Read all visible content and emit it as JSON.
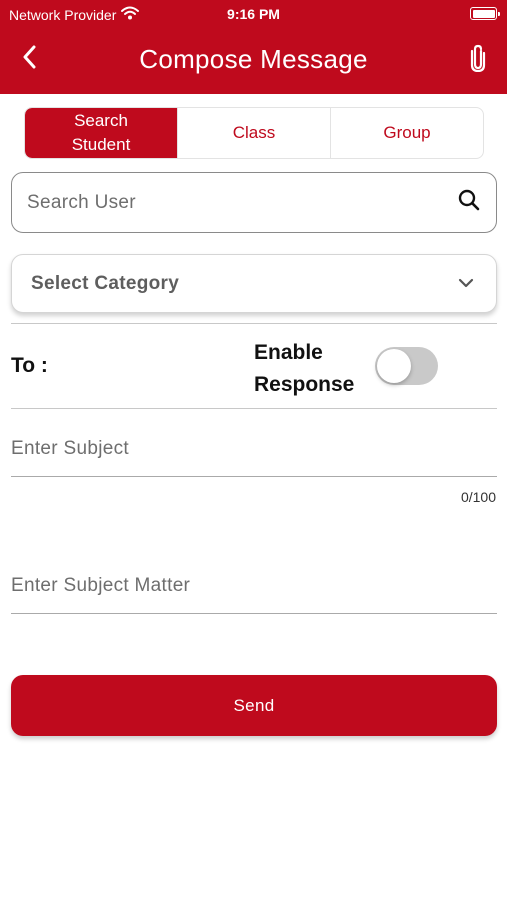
{
  "status_bar": {
    "carrier": "Network Provider",
    "time": "9:16 PM",
    "wifi_icon": "wifi-icon",
    "battery_icon": "battery-icon"
  },
  "header": {
    "title": "Compose Message",
    "back_icon": "chevron-left-icon",
    "attach_icon": "paperclip-icon",
    "background_color": "#bf0a1d"
  },
  "tabs": [
    {
      "label": "Search Student",
      "active": true
    },
    {
      "label": "Class",
      "active": false
    },
    {
      "label": "Group",
      "active": false
    }
  ],
  "search": {
    "placeholder": "Search User",
    "value": "",
    "icon": "search-icon"
  },
  "category": {
    "selected_label": "Select Category",
    "icon": "chevron-down-icon"
  },
  "recipients": {
    "to_label": "To :",
    "enable_response_label": "Enable Response",
    "enable_response_on": false
  },
  "subject": {
    "placeholder": "Enter Subject",
    "value": "",
    "counter": "0/100"
  },
  "body": {
    "placeholder": "Enter Subject Matter",
    "value": ""
  },
  "send_label": "Send",
  "colors": {
    "accent": "#bf0a1d",
    "toggle_off": "#c9c9c9"
  }
}
